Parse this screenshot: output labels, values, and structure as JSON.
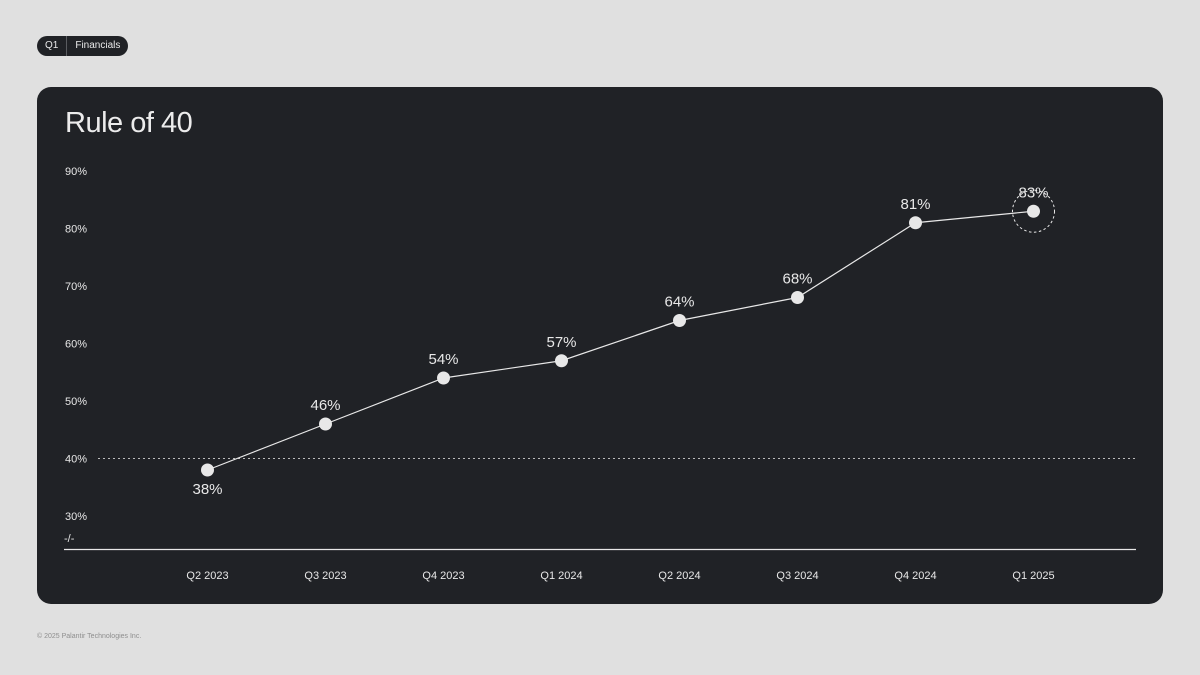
{
  "tag": {
    "quarter": "Q1",
    "section": "Financials"
  },
  "footer": "© 2025 Palantir Technologies Inc.",
  "colors": {
    "page_bg": "#e0e0e0",
    "card_bg": "#202226",
    "foreground": "#e8e8e8"
  },
  "chart_data": {
    "type": "line",
    "title": "Rule of 40",
    "xlabel": "",
    "ylabel": "",
    "categories": [
      "Q2 2023",
      "Q3 2023",
      "Q4 2023",
      "Q1 2024",
      "Q2 2024",
      "Q3 2024",
      "Q4 2024",
      "Q1 2025"
    ],
    "values": [
      38,
      46,
      54,
      57,
      64,
      68,
      81,
      83
    ],
    "value_labels": [
      "38%",
      "46%",
      "54%",
      "57%",
      "64%",
      "68%",
      "81%",
      "83%"
    ],
    "y_ticks": [
      30,
      40,
      50,
      60,
      70,
      80,
      90
    ],
    "y_tick_labels": [
      "30%",
      "40%",
      "50%",
      "60%",
      "70%",
      "80%",
      "90%"
    ],
    "ylim": [
      30,
      90
    ],
    "axis_break_label": "-/-",
    "reference_line": 40,
    "highlighted_category": "Q1 2025",
    "grid": false
  }
}
